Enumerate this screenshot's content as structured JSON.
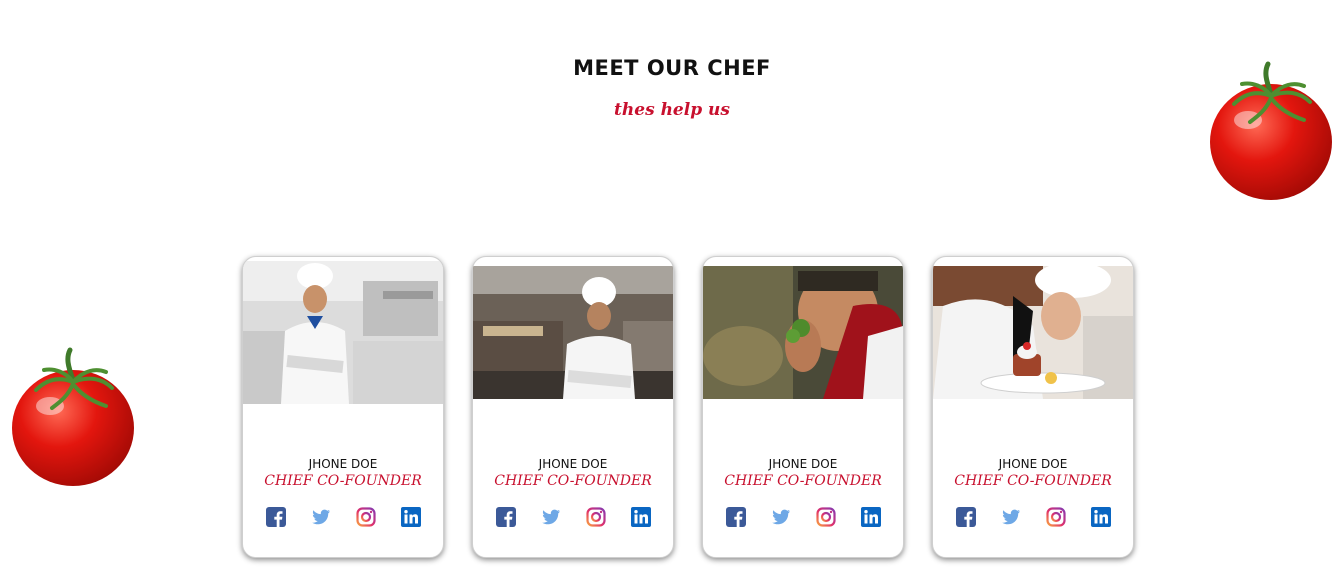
{
  "section": {
    "title": "MEET OUR CHEF",
    "subtitle": "thes help us"
  },
  "decorations": [
    "tomato-image",
    "tomato-image"
  ],
  "colors": {
    "accent": "#c8102e",
    "facebook": "#3b5998",
    "twitter": "#6ea8e6",
    "linkedin": "#0a66c2"
  },
  "chefs": [
    {
      "name": "JHONE DOE",
      "role": "CHIEF CO-FOUNDER",
      "photo": "chef-arms-crossed-kitchen"
    },
    {
      "name": "JHONE DOE",
      "role": "CHIEF CO-FOUNDER",
      "photo": "chef-smiling-kitchen"
    },
    {
      "name": "JHONE DOE",
      "role": "CHIEF CO-FOUNDER",
      "photo": "chef-smelling-herb"
    },
    {
      "name": "JHONE DOE",
      "role": "CHIEF CO-FOUNDER",
      "photo": "chef-plating-dessert"
    }
  ],
  "social_icons": [
    "facebook-icon",
    "twitter-icon",
    "instagram-icon",
    "linkedin-icon"
  ]
}
